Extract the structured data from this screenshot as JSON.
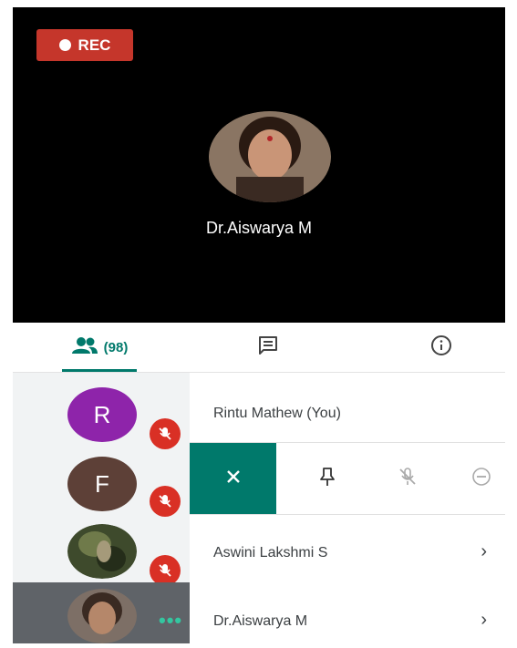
{
  "recording": {
    "label": "REC"
  },
  "speaker": {
    "name": "Dr.Aiswarya M"
  },
  "tabs": {
    "people_count": "(98)"
  },
  "participants": [
    {
      "initial": "R",
      "name": "Rintu Mathew (You)",
      "avatar_color": "#8e24aa",
      "muted": true
    },
    {
      "initial": "F",
      "name": "",
      "avatar_color": "#5d4037",
      "muted": true
    },
    {
      "initial": "",
      "name": "Aswini Lakshmi S",
      "muted": true
    },
    {
      "initial": "",
      "name": "Dr.Aiswarya M",
      "muted": false
    }
  ],
  "colors": {
    "accent": "#00796b",
    "rec": "#c5362b",
    "mute": "#d93025"
  }
}
